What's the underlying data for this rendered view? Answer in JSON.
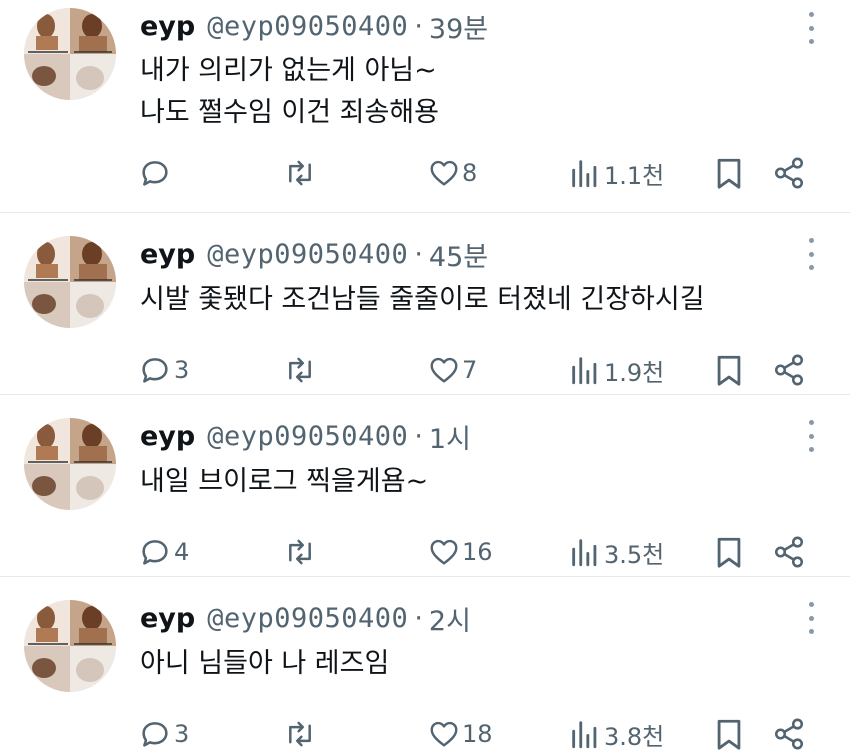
{
  "colors": {
    "text": "#0f1419",
    "secondary": "#536471",
    "divider": "#e7e9ec"
  },
  "tweets": [
    {
      "name": "eyp",
      "handle": "@eyp09050400",
      "separator": "·",
      "time": "39분",
      "lines": [
        "내가 의리가 없는게 아님~",
        "나도 쩔수임 이건 죄송해용"
      ],
      "replies": "",
      "retweets": "",
      "likes": "8",
      "views": "1.1천"
    },
    {
      "name": "eyp",
      "handle": "@eyp09050400",
      "separator": "·",
      "time": "45분",
      "lines": [
        "시발 좇됐다 조건남들 줄줄이로 터졌네 긴장하시길"
      ],
      "replies": "3",
      "retweets": "",
      "likes": "7",
      "views": "1.9천"
    },
    {
      "name": "eyp",
      "handle": "@eyp09050400",
      "separator": "·",
      "time": "1시",
      "lines": [
        "내일 브이로그 찍을게욤~"
      ],
      "replies": "4",
      "retweets": "",
      "likes": "16",
      "views": "3.5천"
    },
    {
      "name": "eyp",
      "handle": "@eyp09050400",
      "separator": "·",
      "time": "2시",
      "lines": [
        "아니 님들아 나 레즈임"
      ],
      "replies": "3",
      "retweets": "",
      "likes": "18",
      "views": "3.8천"
    }
  ]
}
